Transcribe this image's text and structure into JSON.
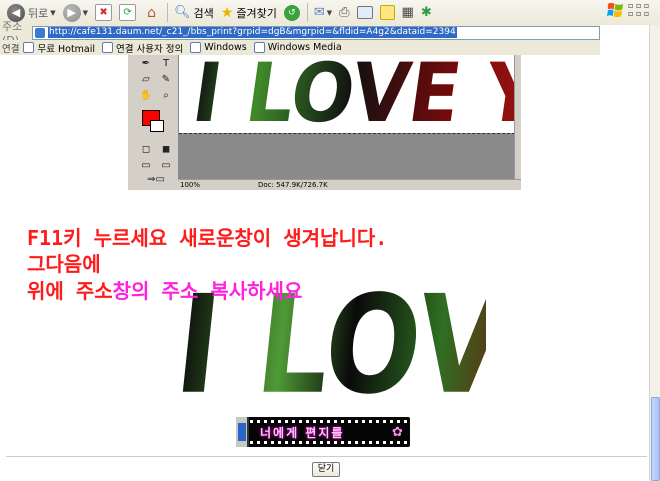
{
  "toolbar": {
    "back_label": "뒤로",
    "search_label": "검색",
    "favorites_label": "즐겨찾기",
    "colors": {
      "refresh": "#2ea32e",
      "stop": "#d62a2a",
      "search": "#3c78c8",
      "favorites": "#e9b400"
    }
  },
  "address": {
    "label": "주소(D)",
    "url": "http://cafe131.daum.net/_c21_/bbs_print?grpid=dgB&mgrpid=&fldid=A4g2&dataid=2394"
  },
  "links": {
    "label": "연결",
    "items": [
      "무료 Hotmail",
      "연결 사용자 정의",
      "Windows",
      "Windows Media"
    ]
  },
  "photoshop": {
    "zoom": "100%",
    "doc_info": "Doc: 547.9K/726.7K",
    "canvas_text": "I LOVE YOU !"
  },
  "message": {
    "line1": "F11키 누르세요 새로운창이 생겨납니다.",
    "line2": "그다음에",
    "line3_red": "위에 주소",
    "line3_pink": "창의 주소 복사하세요",
    "colors": {
      "red": "#ff1b1b",
      "pink": "#ff22dd"
    }
  },
  "image_text": "I LOVE YOU !",
  "banner": {
    "text": "너에게 편지를"
  },
  "close_button": "닫기"
}
